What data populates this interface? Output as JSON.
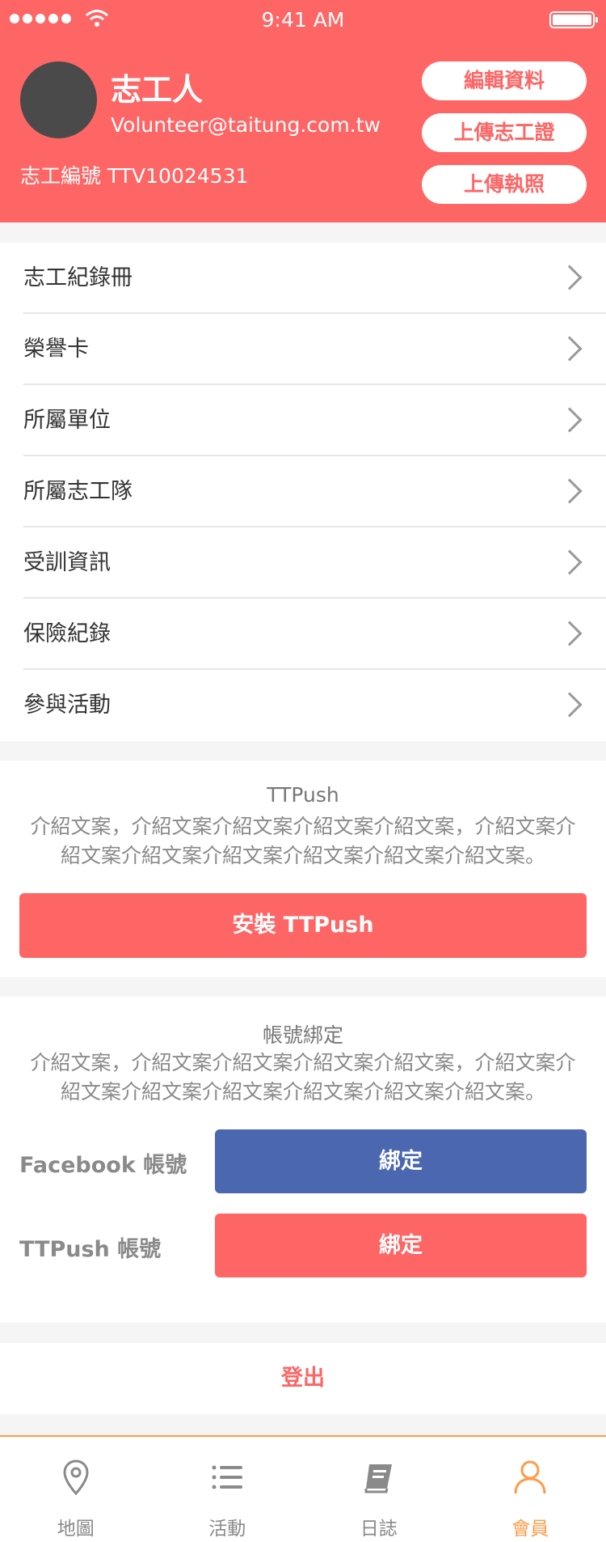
{
  "status": {
    "time": "9:41 AM"
  },
  "profile": {
    "name": "志工人",
    "email": "Volunteer@taitung.com.tw",
    "volunteer_id": "志工編號 TTV10024531",
    "buttons": {
      "edit": "編輯資料",
      "upload_card": "上傳志工證",
      "upload_license": "上傳執照"
    }
  },
  "menu": [
    {
      "label": "志工紀錄冊"
    },
    {
      "label": "榮譽卡"
    },
    {
      "label": "所屬單位"
    },
    {
      "label": "所屬志工隊"
    },
    {
      "label": "受訓資訊"
    },
    {
      "label": "保險紀錄"
    },
    {
      "label": "參與活動"
    }
  ],
  "ttpush": {
    "title": "TTPush",
    "desc_line1": "介紹文案，介紹文案介紹文案介紹文案介紹文案，介紹文案介",
    "desc_line2": "紹文案介紹文案介紹文案介紹文案介紹文案介紹文案。",
    "install_label": "安裝 TTPush"
  },
  "binding": {
    "title": "帳號綁定",
    "desc_line1": "介紹文案，介紹文案介紹文案介紹文案介紹文案，介紹文案介",
    "desc_line2": "紹文案介紹文案介紹文案介紹文案介紹文案介紹文案。",
    "facebook_label": "Facebook 帳號",
    "ttpush_label": "TTPush 帳號",
    "bind_button": "綁定",
    "colors": {
      "facebook": "#4a67b0",
      "ttpush": "#fe6565"
    }
  },
  "logout_label": "登出",
  "tabs": [
    {
      "label": "地圖",
      "icon": "map-pin-icon"
    },
    {
      "label": "活動",
      "icon": "list-icon"
    },
    {
      "label": "日誌",
      "icon": "book-icon"
    },
    {
      "label": "會員",
      "icon": "user-icon",
      "active": true
    }
  ],
  "colors": {
    "brand": "#fe6565",
    "tab_active": "#ff9b48"
  }
}
